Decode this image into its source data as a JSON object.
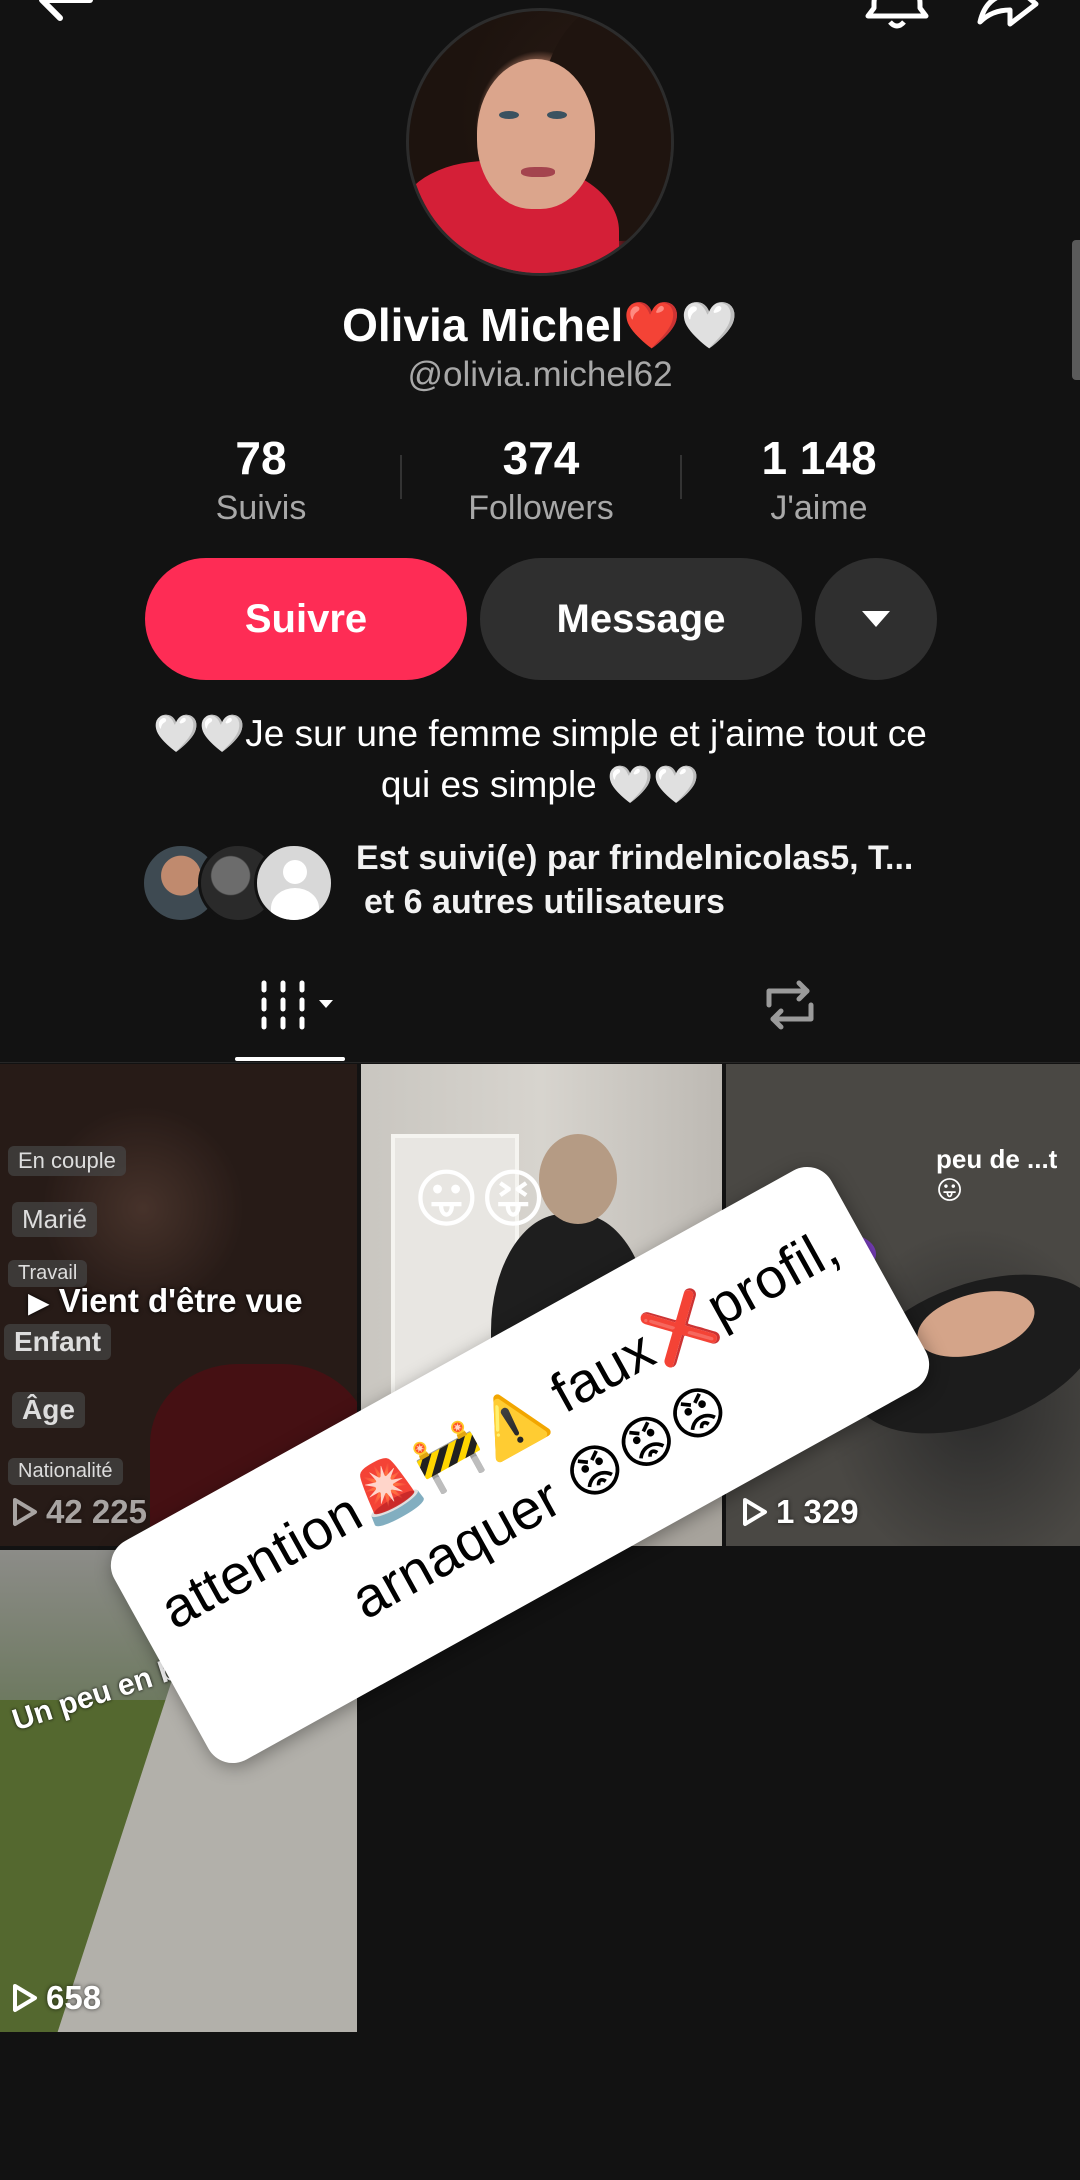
{
  "header": {
    "back_icon": "back-arrow-icon",
    "bell_icon": "bell-icon",
    "share_icon": "share-icon"
  },
  "profile": {
    "name": "Olivia Michel❤️🤍",
    "handle": "@olivia.michel62",
    "bio_line1": "🤍🤍Je sur une femme simple et j'aime tout ce",
    "bio_line2": "qui es simple 🤍🤍"
  },
  "stats": [
    {
      "value": "78",
      "label": "Suivis"
    },
    {
      "value": "374",
      "label": "Followers"
    },
    {
      "value": "1 148",
      "label": "J'aime"
    }
  ],
  "actions": {
    "follow": "Suivre",
    "message": "Message",
    "more_icon": "caret-down-icon"
  },
  "followed_by": {
    "line1": "Est suivi(e) par frindelnicolas5, T...",
    "line2": "et 6 autres utilisateurs"
  },
  "tabs": {
    "videos_icon": "grid-icon",
    "reposts_icon": "repost-icon"
  },
  "videos": [
    {
      "overlay": "Vient d'être vue",
      "views": "42 225",
      "tags": [
        "En couple",
        "Marié",
        "Travail",
        "Enfant",
        "Âge",
        "Nationalité"
      ]
    },
    {
      "emoji": "😛😝",
      "views": ""
    },
    {
      "caption": "peu de ...t 😛",
      "views": "1 329"
    },
    {
      "caption": "Un peu en balade 🏃‍♀️",
      "views": "658"
    }
  ],
  "sticker": {
    "line1": "attention🚨🚧⚠️ faux❌profil,",
    "line2": "arnaquer 😡😡😡"
  },
  "colors": {
    "accent": "#fe2c55",
    "background": "#121212",
    "secondary_button": "#2f2f2f"
  }
}
